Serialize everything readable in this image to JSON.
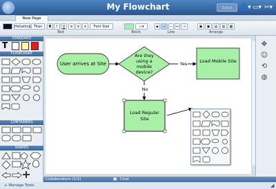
{
  "app": {
    "title": "My Flowchart",
    "save_label": "Save"
  },
  "tabs": [
    {
      "label": "New Page"
    }
  ],
  "toolbar": {
    "font_name": "Helvetica",
    "font_style": "Titan",
    "font_size_label": "Font Size",
    "bold": "B",
    "italic": "I",
    "underline": "U",
    "groups": {
      "text": "Text",
      "block": "Block",
      "line": "Line",
      "arrange": "Arrange"
    }
  },
  "left_panel": {
    "sections": {
      "standard": "STANDARD",
      "flowchart": "FLOWCHART",
      "containers": "CONTAINERS",
      "shapes": "SHAPES"
    },
    "text_tool": "T",
    "manage_tools": "+ Manage Tools"
  },
  "diagram": {
    "start_label": "User arrives at Site",
    "decision_label": "Are they using a mobile device?",
    "yes_label": "Yes",
    "no_label": "No",
    "mobile_label": "Load Mobile Site",
    "regular_label": "Load Regular Site"
  },
  "bottom": {
    "collaborators": "Collaborators (1/1)",
    "chat": "Chat"
  },
  "colors": {
    "accent": "#3c6599",
    "shape_fill": "#a8f0a8",
    "shape_stroke": "#333333"
  }
}
